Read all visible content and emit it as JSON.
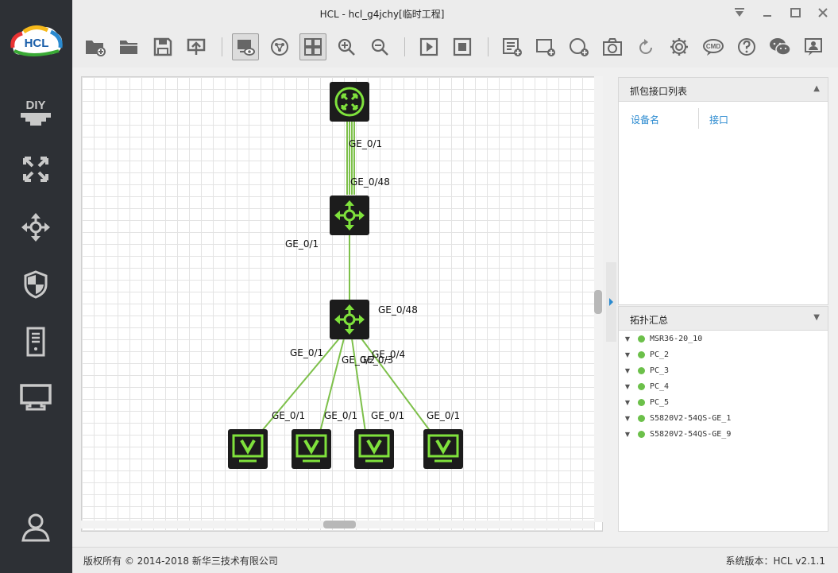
{
  "window": {
    "title": "HCL - hcl_g4jchy[临时工程]",
    "controls": [
      "menu-down-icon",
      "minimize-icon",
      "maximize-icon",
      "close-icon"
    ]
  },
  "sidebar": {
    "logo_text": "HCL",
    "items": [
      {
        "name": "diy",
        "icon": "diy-icon"
      },
      {
        "name": "switch",
        "icon": "switch-icon"
      },
      {
        "name": "router",
        "icon": "router-icon"
      },
      {
        "name": "security",
        "icon": "shield-icon"
      },
      {
        "name": "server",
        "icon": "server-icon"
      },
      {
        "name": "terminal",
        "icon": "monitor-icon"
      },
      {
        "name": "user",
        "icon": "user-icon"
      }
    ]
  },
  "toolbar": {
    "buttons": [
      "new-project-icon",
      "open-project-icon",
      "save-icon",
      "export-icon",
      "show-interface-icon",
      "topology-icon",
      "grid-icon",
      "zoom-in-icon",
      "zoom-out-icon",
      "start-all-icon",
      "stop-all-icon",
      "list-icon",
      "add-rect-icon",
      "add-circle-icon",
      "screenshot-icon",
      "undo-icon",
      "settings-icon",
      "cmd-icon",
      "help-icon",
      "wechat-icon",
      "feedback-icon"
    ]
  },
  "canvas": {
    "link_labels": [
      {
        "text": "GE_0/1"
      },
      {
        "text": "GE_0/48"
      },
      {
        "text": "GE_0/1"
      },
      {
        "text": "GE_0/48"
      },
      {
        "text": "GE_0/1"
      },
      {
        "text": "GE_0/4"
      },
      {
        "text": "GE_0/3"
      },
      {
        "text": "GE_0/2"
      },
      {
        "text": "GE_0/1"
      },
      {
        "text": "GE_0/1"
      },
      {
        "text": "GE_0/1"
      },
      {
        "text": "GE_0/1"
      }
    ],
    "devices": [
      {
        "type": "switch-core"
      },
      {
        "type": "switch"
      },
      {
        "type": "switch"
      },
      {
        "type": "pc"
      },
      {
        "type": "pc"
      },
      {
        "type": "pc"
      },
      {
        "type": "pc"
      }
    ],
    "colors": {
      "link": "#7dc04a",
      "device_bg": "#1c1c1c",
      "device_icon": "#7fe23c"
    }
  },
  "capture_panel": {
    "title": "抓包接口列表",
    "col_device": "设备名",
    "col_interface": "接口"
  },
  "topology_summary": {
    "title": "拓扑汇总",
    "items": [
      "MSR36-20_10",
      "PC_2",
      "PC_3",
      "PC_4",
      "PC_5",
      "S5820V2-54QS-GE_1",
      "S5820V2-54QS-GE_9"
    ]
  },
  "status": {
    "copyright": "版权所有 © 2014-2018 新华三技术有限公司",
    "version": "系统版本：HCL v2.1.1"
  }
}
